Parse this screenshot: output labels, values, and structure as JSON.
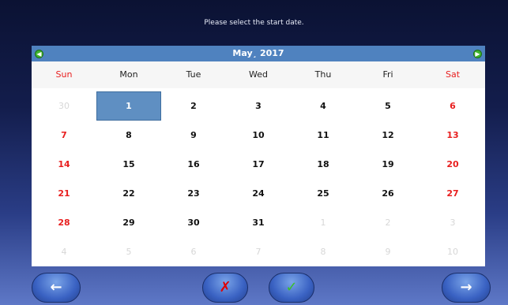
{
  "prompt": "Please select the start date.",
  "calendar": {
    "month_label": "May¸ 2017",
    "prev_icon": "arrow-left-icon",
    "next_icon": "arrow-right-icon",
    "weekdays": [
      "Sun",
      "Mon",
      "Tue",
      "Wed",
      "Thu",
      "Fri",
      "Sat"
    ],
    "weeks": [
      [
        "30",
        "1",
        "2",
        "3",
        "4",
        "5",
        "6"
      ],
      [
        "7",
        "8",
        "9",
        "10",
        "11",
        "12",
        "13"
      ],
      [
        "14",
        "15",
        "16",
        "17",
        "18",
        "19",
        "20"
      ],
      [
        "21",
        "22",
        "23",
        "24",
        "25",
        "26",
        "27"
      ],
      [
        "28",
        "29",
        "30",
        "31",
        "1",
        "2",
        "3"
      ],
      [
        "4",
        "5",
        "6",
        "7",
        "8",
        "9",
        "10"
      ]
    ],
    "selected_day": "1",
    "weekend_color": "#e81f1f",
    "selected_color": "#5f8fc2",
    "header_color": "#4f82bf"
  },
  "buttons": {
    "back": {
      "icon": "arrow-left-icon",
      "glyph": "←"
    },
    "cancel": {
      "icon": "close-icon",
      "glyph": "✗"
    },
    "confirm": {
      "icon": "check-icon",
      "glyph": "✓"
    },
    "next": {
      "icon": "arrow-right-icon",
      "glyph": "→"
    }
  }
}
